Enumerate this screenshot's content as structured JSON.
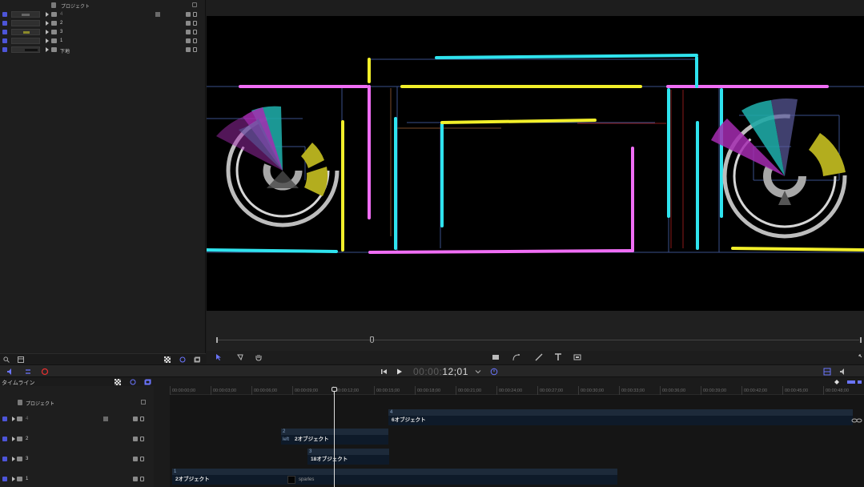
{
  "layers": {
    "project_label": "プロジェクト",
    "rows": [
      {
        "name": "4"
      },
      {
        "name": "2"
      },
      {
        "name": "3"
      },
      {
        "name": "1"
      },
      {
        "name": "下地"
      }
    ]
  },
  "transport": {
    "timecode_dim": "00:00:",
    "timecode_bright": "12;01"
  },
  "timeline": {
    "title": "タイムライン",
    "project_label": "プロジェクト",
    "rows": [
      {
        "name": "4"
      },
      {
        "name": "2"
      },
      {
        "name": "3"
      },
      {
        "name": "1"
      }
    ],
    "ruler": [
      "00:00:00;00",
      "00:00:03;00",
      "00:00:06;00",
      "00:00:09;00",
      "00:00:12;00",
      "00:00:15;00",
      "00:00:18;00",
      "00:00:21;00",
      "00:00:24;00",
      "00:00:27;00",
      "00:00:30;00",
      "00:00:33;00",
      "00:00:36;00",
      "00:00:39;00",
      "00:00:42;00",
      "00:00:45;00",
      "00:00:48;00"
    ],
    "clips": {
      "c4_head": "4",
      "c4_body": "6オブジェクト",
      "c2_head": "2",
      "c2_left": "left",
      "c2_body": "2オブジェクト",
      "c3_head": "3",
      "c3_body": "18オブジェクト",
      "c1_head": "1",
      "c1_body": "2オブジェクト",
      "sparkle_label": "sparles"
    }
  },
  "colors": {
    "accent": "#4d55d8",
    "cyan": "#2fe3ee",
    "magenta": "#f06ef5",
    "yellow": "#f2ef2a",
    "purple": "#a42bb0",
    "olive": "#b3ad1e",
    "teal": "#1ea7a4"
  }
}
